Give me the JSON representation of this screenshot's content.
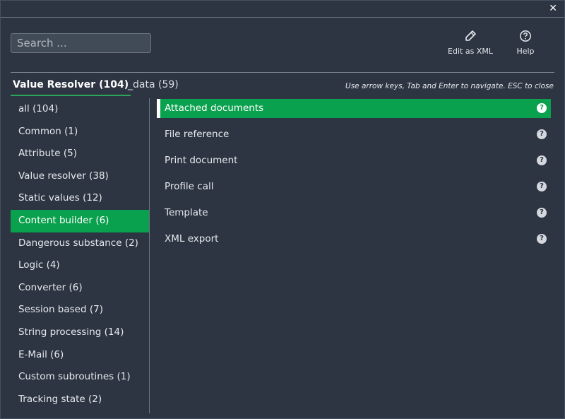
{
  "window": {
    "close_glyph": "✕"
  },
  "search": {
    "placeholder": "Search ..."
  },
  "toolbar": {
    "edit_xml_label": "Edit as XML",
    "edit_xml_icon": "pencil-icon",
    "help_label": "Help",
    "help_icon": "help-circle-icon"
  },
  "tabs": [
    {
      "label": "Value Resolver (104)",
      "active": true
    },
    {
      "label": "_data (59)",
      "active": false
    }
  ],
  "hint": "Use arrow keys, Tab and Enter to navigate. ESC to close",
  "categories": [
    {
      "label": "all (104)"
    },
    {
      "label": "Common (1)"
    },
    {
      "label": "Attribute (5)"
    },
    {
      "label": "Value resolver (38)"
    },
    {
      "label": "Static values (12)"
    },
    {
      "label": "Content builder (6)",
      "active": true
    },
    {
      "label": "Dangerous substance (2)"
    },
    {
      "label": "Logic (4)"
    },
    {
      "label": "Converter (6)"
    },
    {
      "label": "Session based (7)"
    },
    {
      "label": "String processing (14)"
    },
    {
      "label": "E-Mail (6)"
    },
    {
      "label": "Custom subroutines (1)"
    },
    {
      "label": "Tracking state (2)"
    }
  ],
  "items": [
    {
      "label": "Attached documents",
      "active": true
    },
    {
      "label": "File reference"
    },
    {
      "label": "Print document"
    },
    {
      "label": "Profile call"
    },
    {
      "label": "Template"
    },
    {
      "label": "XML export"
    }
  ],
  "help_glyph": "?",
  "colors": {
    "background": "#2d3542",
    "accent": "#0aa14e",
    "tab_underline": "#2ea45a"
  }
}
